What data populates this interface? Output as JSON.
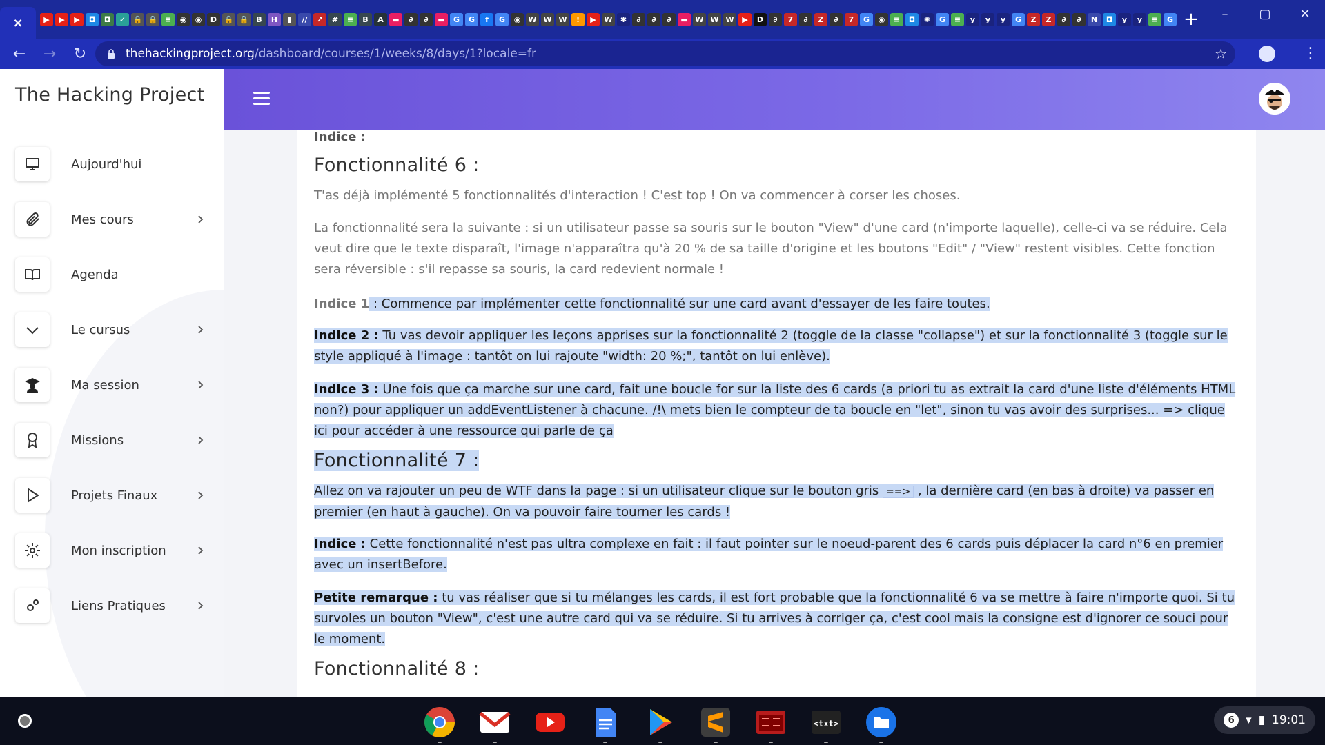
{
  "browser": {
    "tab_close_glyph": "×",
    "new_tab_glyph": "+",
    "pinned_tabs": [
      {
        "icon": "youtube-icon",
        "color": "#e62117",
        "glyph": "▶"
      },
      {
        "icon": "youtube-icon",
        "color": "#e62117",
        "glyph": "▶"
      },
      {
        "icon": "youtube-icon",
        "color": "#e62117",
        "glyph": "▶"
      },
      {
        "icon": "app-icon",
        "color": "#1e88e5",
        "glyph": "◘"
      },
      {
        "icon": "app-icon",
        "color": "#3d7b47",
        "glyph": "◘"
      },
      {
        "icon": "shield-icon",
        "color": "#2aa198",
        "glyph": "✓"
      },
      {
        "icon": "lock-icon",
        "color": "#555555",
        "glyph": "🔒"
      },
      {
        "icon": "lock-icon",
        "color": "#555555",
        "glyph": "🔒"
      },
      {
        "icon": "app-icon",
        "color": "#4caf50",
        "glyph": "≡"
      },
      {
        "icon": "app-icon",
        "color": "#333333",
        "glyph": "◉"
      },
      {
        "icon": "app-icon",
        "color": "#333333",
        "glyph": "◉"
      },
      {
        "icon": "app-icon",
        "color": "#333333",
        "glyph": "D"
      },
      {
        "icon": "lock-icon",
        "color": "#555555",
        "glyph": "🔒"
      },
      {
        "icon": "lock-icon",
        "color": "#555555",
        "glyph": "🔒"
      },
      {
        "icon": "app-icon",
        "color": "#37474f",
        "glyph": "B"
      },
      {
        "icon": "app-icon",
        "color": "#7e57c2",
        "glyph": "H"
      },
      {
        "icon": "app-icon",
        "color": "#555555",
        "glyph": "▮"
      },
      {
        "icon": "app-icon",
        "color": "#3949ab",
        "glyph": "//"
      },
      {
        "icon": "app-icon",
        "color": "#c62828",
        "glyph": "↗"
      },
      {
        "icon": "app-icon",
        "color": "#37474f",
        "glyph": "#"
      },
      {
        "icon": "app-icon",
        "color": "#4caf50",
        "glyph": "≡"
      },
      {
        "icon": "app-icon",
        "color": "#37474f",
        "glyph": "B"
      },
      {
        "icon": "app-icon",
        "color": "#263238",
        "glyph": "A"
      },
      {
        "icon": "app-icon",
        "color": "#e91e63",
        "glyph": "▬"
      },
      {
        "icon": "app-icon",
        "color": "#333333",
        "glyph": "∂"
      },
      {
        "icon": "app-icon",
        "color": "#333333",
        "glyph": "∂"
      },
      {
        "icon": "app-icon",
        "color": "#e91e63",
        "glyph": "▬"
      },
      {
        "icon": "google-icon",
        "color": "#4285f4",
        "glyph": "G"
      },
      {
        "icon": "google-icon",
        "color": "#4285f4",
        "glyph": "G"
      },
      {
        "icon": "facebook-icon",
        "color": "#1877f2",
        "glyph": "f"
      },
      {
        "icon": "google-icon",
        "color": "#4285f4",
        "glyph": "G"
      },
      {
        "icon": "app-icon",
        "color": "#333333",
        "glyph": "◉"
      },
      {
        "icon": "wikipedia-icon",
        "color": "#444444",
        "glyph": "W"
      },
      {
        "icon": "wikipedia-icon",
        "color": "#444444",
        "glyph": "W"
      },
      {
        "icon": "wikipedia-icon",
        "color": "#444444",
        "glyph": "W"
      },
      {
        "icon": "app-icon",
        "color": "#ff9800",
        "glyph": "!"
      },
      {
        "icon": "youtube-icon",
        "color": "#e62117",
        "glyph": "▶"
      },
      {
        "icon": "wikipedia-icon",
        "color": "#444444",
        "glyph": "W"
      },
      {
        "icon": "app-icon",
        "color": "#1a237e",
        "glyph": "✱"
      },
      {
        "icon": "app-icon",
        "color": "#333333",
        "glyph": "∂"
      },
      {
        "icon": "app-icon",
        "color": "#333333",
        "glyph": "∂"
      },
      {
        "icon": "app-icon",
        "color": "#333333",
        "glyph": "∂"
      },
      {
        "icon": "app-icon",
        "color": "#e91e63",
        "glyph": "▬"
      },
      {
        "icon": "wikipedia-icon",
        "color": "#444444",
        "glyph": "W"
      },
      {
        "icon": "wikipedia-icon",
        "color": "#444444",
        "glyph": "W"
      },
      {
        "icon": "wikipedia-icon",
        "color": "#444444",
        "glyph": "W"
      },
      {
        "icon": "youtube-icon",
        "color": "#e62117",
        "glyph": "▶"
      },
      {
        "icon": "dev-icon",
        "color": "#111111",
        "glyph": "D"
      },
      {
        "icon": "app-icon",
        "color": "#333333",
        "glyph": "∂"
      },
      {
        "icon": "app-icon",
        "color": "#c62828",
        "glyph": "7"
      },
      {
        "icon": "app-icon",
        "color": "#333333",
        "glyph": "∂"
      },
      {
        "icon": "app-icon",
        "color": "#c62828",
        "glyph": "Z"
      },
      {
        "icon": "app-icon",
        "color": "#333333",
        "glyph": "∂"
      },
      {
        "icon": "app-icon",
        "color": "#c62828",
        "glyph": "7"
      },
      {
        "icon": "google-icon",
        "color": "#4285f4",
        "glyph": "G"
      },
      {
        "icon": "app-icon",
        "color": "#333333",
        "glyph": "◉"
      },
      {
        "icon": "app-icon",
        "color": "#4caf50",
        "glyph": "≡"
      },
      {
        "icon": "app-icon",
        "color": "#1e88e5",
        "glyph": "◘"
      },
      {
        "icon": "app-icon",
        "color": "#1a237e",
        "glyph": "✺"
      },
      {
        "icon": "google-icon",
        "color": "#4285f4",
        "glyph": "G"
      },
      {
        "icon": "app-icon",
        "color": "#4caf50",
        "glyph": "≡"
      },
      {
        "icon": "app-icon",
        "color": "#1a237e",
        "glyph": "y"
      },
      {
        "icon": "app-icon",
        "color": "#1a237e",
        "glyph": "y"
      },
      {
        "icon": "app-icon",
        "color": "#1a237e",
        "glyph": "y"
      },
      {
        "icon": "google-icon",
        "color": "#4285f4",
        "glyph": "G"
      },
      {
        "icon": "app-icon",
        "color": "#c62828",
        "glyph": "Z"
      },
      {
        "icon": "app-icon",
        "color": "#c62828",
        "glyph": "Z"
      },
      {
        "icon": "app-icon",
        "color": "#333333",
        "glyph": "∂"
      },
      {
        "icon": "app-icon",
        "color": "#333333",
        "glyph": "∂"
      },
      {
        "icon": "app-icon",
        "color": "#3949ab",
        "glyph": "N"
      },
      {
        "icon": "app-icon",
        "color": "#1e88e5",
        "glyph": "◘"
      },
      {
        "icon": "app-icon",
        "color": "#1a237e",
        "glyph": "y"
      },
      {
        "icon": "app-icon",
        "color": "#1a237e",
        "glyph": "y"
      },
      {
        "icon": "app-icon",
        "color": "#4caf50",
        "glyph": "≡"
      },
      {
        "icon": "google-icon",
        "color": "#4285f4",
        "glyph": "G"
      }
    ],
    "url_host": "thehackingproject.org",
    "url_path": "/dashboard/courses/1/weeks/8/days/1?locale=fr"
  },
  "sidebar": {
    "brand": "The Hacking Project",
    "items": [
      {
        "label": "Aujourd'hui",
        "icon": "monitor-icon",
        "has_chevron": false
      },
      {
        "label": "Mes cours",
        "icon": "paperclip-icon",
        "has_chevron": true
      },
      {
        "label": "Agenda",
        "icon": "book-icon",
        "has_chevron": false
      },
      {
        "label": "Le cursus",
        "icon": "chevron-down-icon",
        "has_chevron": true
      },
      {
        "label": "Ma session",
        "icon": "graduate-icon",
        "has_chevron": true
      },
      {
        "label": "Missions",
        "icon": "award-icon",
        "has_chevron": true
      },
      {
        "label": "Projets Finaux",
        "icon": "play-icon",
        "has_chevron": true
      },
      {
        "label": "Mon inscription",
        "icon": "gear-icon",
        "has_chevron": true
      },
      {
        "label": "Liens Pratiques",
        "icon": "gears-icon",
        "has_chevron": true
      }
    ]
  },
  "content": {
    "indice_top": "Indice :",
    "f6_title": "Fonctionnalité 6 :",
    "f6_p1": "T'as déjà implémenté 5 fonctionnalités d'interaction ! C'est top ! On va commencer à corser les choses.",
    "f6_p2": "La fonctionnalité sera la suivante : si un utilisateur passe sa souris sur le bouton \"View\" d'une card (n'importe laquelle), celle-ci va se réduire. Cela veut dire que le texte disparaît, l'image n'apparaîtra qu'à 20 % de sa taille d'origine et les boutons \"Edit\" / \"View\" restent visibles. Cette fonction sera réversible : s'il repasse sa souris, la card redevient normale !",
    "f6_i1_label": "Indice 1",
    "f6_i1_text": " : Commence par implémenter cette fonctionnalité sur une card avant d'essayer de les faire toutes.",
    "f6_i2_label": "Indice 2 :",
    "f6_i2_text": " Tu vas devoir appliquer les leçons apprises sur la fonctionnalité 2 (toggle de la classe \"collapse\") et sur la fonctionnalité 3 (toggle sur le style appliqué à l'image : tantôt on lui rajoute \"width: 20 %;\", tantôt on lui enlève).",
    "f6_i3_label": "Indice 3 :",
    "f6_i3_text": " Une fois que ça marche sur une card, fait une boucle for sur la liste des 6 cards (a priori tu as extrait la card d'une liste d'éléments HTML non?) pour appliquer un addEventListener à chacune. /!\\ mets bien le compteur de ta boucle en \"let\", sinon tu vas avoir des surprises... => clique ici pour accéder à une ressource qui parle de ça",
    "f7_title": "Fonctionnalité 7 :",
    "f7_p1_a": "Allez on va rajouter un peu de WTF dans la page : si un utilisateur clique sur le bouton gris ",
    "f7_p1_btn": "==>",
    "f7_p1_b": " , la dernière card (en bas à droite) va passer en premier (en haut à gauche). On va pouvoir faire tourner les cards !",
    "f7_indice_label": "Indice :",
    "f7_indice_text": " Cette fonctionnalité n'est pas ultra complexe en fait : il faut pointer sur le noeud-parent des 6 cards puis déplacer la card n°6 en premier avec un insertBefore.",
    "f7_remarque_label": "Petite remarque :",
    "f7_remarque_text": " tu vas réaliser que si tu mélanges les cards, il est fort probable que la fonctionnalité 6 va se mettre à faire n'importe quoi. Si tu survoles un bouton \"View\", c'est une autre card qui va se réduire. Si tu arrives à corriger ça, c'est cool mais la consigne est d'ignorer ce souci pour le moment.",
    "f8_title": "Fonctionnalité 8 :"
  },
  "shelf": {
    "apps": [
      {
        "name": "chrome-app",
        "color": "#ffffff"
      },
      {
        "name": "gmail-app",
        "color": "#ffffff"
      },
      {
        "name": "youtube-app",
        "color": "#e62117"
      },
      {
        "name": "docs-app",
        "color": "#4285f4"
      },
      {
        "name": "play-store-app",
        "color": "#ffffff"
      },
      {
        "name": "sublime-text-app",
        "color": "#3d3d3d"
      },
      {
        "name": "terminal-app",
        "color": "#b71c1c"
      },
      {
        "name": "text-app",
        "color": "#222222"
      },
      {
        "name": "files-app",
        "color": "#1a73e8"
      }
    ],
    "notification_count": "6",
    "clock": "19:01"
  }
}
